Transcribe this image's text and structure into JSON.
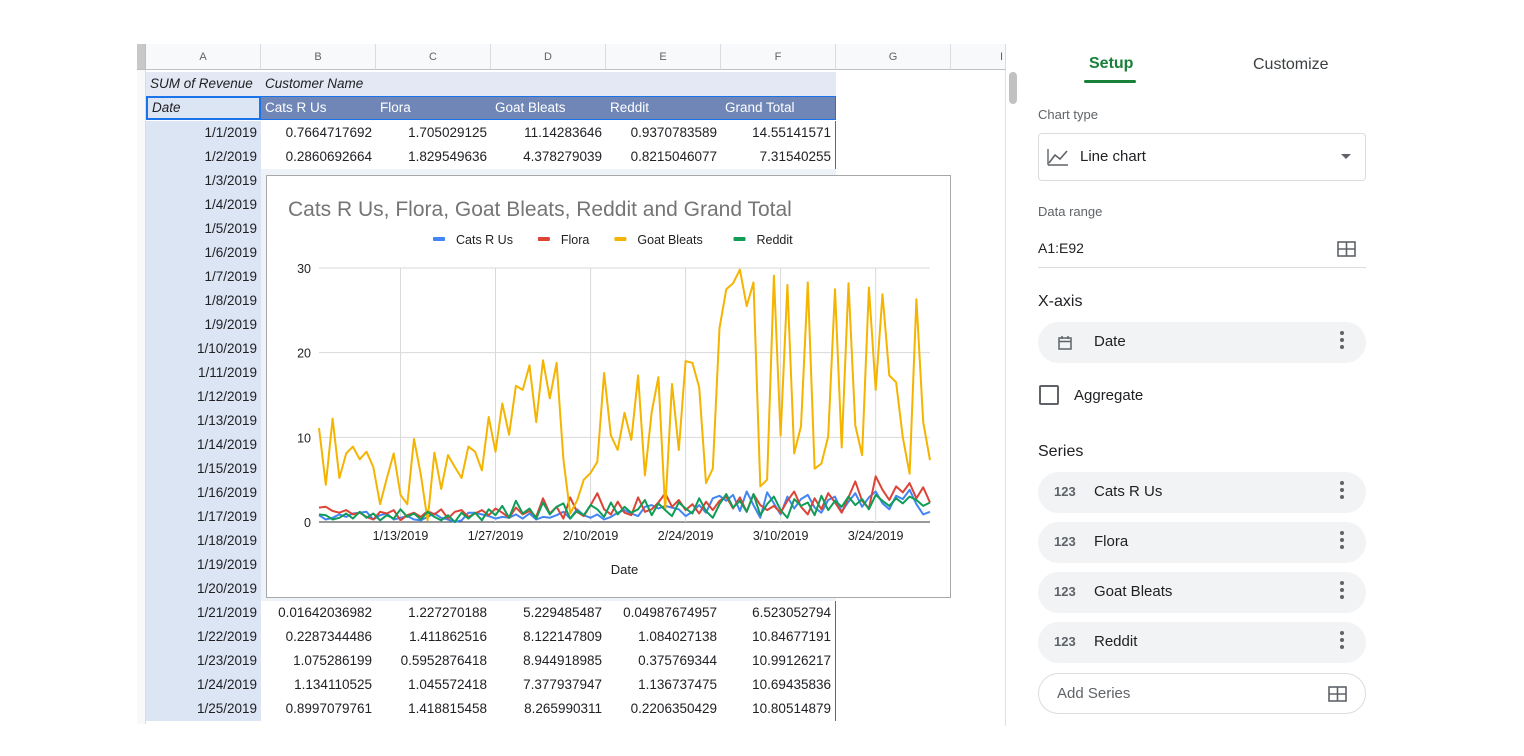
{
  "sheet": {
    "columns": [
      "A",
      "B",
      "C",
      "D",
      "E",
      "F",
      "G",
      "I"
    ],
    "pivot_title": "SUM of Revenue",
    "customer_label": "Customer Name",
    "header_row": [
      "Date",
      "Cats R Us",
      "Flora",
      "Goat Bleats",
      "Reddit",
      "Grand Total"
    ],
    "rows": [
      [
        "1/1/2019",
        "0.7664717692",
        "1.705029125",
        "11.14283646",
        "0.9370783589",
        "14.55141571"
      ],
      [
        "1/2/2019",
        "0.2860692664",
        "1.829549636",
        "4.378279039",
        "0.8215046077",
        "7.31540255"
      ],
      [
        "1/3/2019"
      ],
      [
        "1/4/2019"
      ],
      [
        "1/5/2019"
      ],
      [
        "1/6/2019"
      ],
      [
        "1/7/2019"
      ],
      [
        "1/8/2019"
      ],
      [
        "1/9/2019"
      ],
      [
        "1/10/2019"
      ],
      [
        "1/11/2019"
      ],
      [
        "1/12/2019"
      ],
      [
        "1/13/2019"
      ],
      [
        "1/14/2019"
      ],
      [
        "1/15/2019"
      ],
      [
        "1/16/2019"
      ],
      [
        "1/17/2019"
      ],
      [
        "1/18/2019"
      ],
      [
        "1/19/2019"
      ],
      [
        "1/20/2019"
      ],
      [
        "1/21/2019",
        "0.01642036982",
        "1.227270188",
        "5.229485487",
        "0.04987674957",
        "6.523052794"
      ],
      [
        "1/22/2019",
        "0.2287344486",
        "1.411862516",
        "8.122147809",
        "1.084027138",
        "10.84677191"
      ],
      [
        "1/23/2019",
        "1.075286199",
        "0.5952876418",
        "8.944918985",
        "0.375769344",
        "10.99126217"
      ],
      [
        "1/24/2019",
        "1.134110525",
        "1.045572418",
        "7.377937947",
        "1.136737475",
        "10.69435836"
      ],
      [
        "1/25/2019",
        "0.8997079761",
        "1.418815458",
        "8.265990311",
        "0.2206350429",
        "10.80514879"
      ]
    ]
  },
  "chart_data": {
    "type": "line",
    "title": "Cats R Us, Flora, Goat Bleats, Reddit and Grand Total",
    "xlabel": "Date",
    "ylabel": "",
    "ylim": [
      0,
      30
    ],
    "yticks": [
      0,
      10,
      20,
      30
    ],
    "xticks": [
      "1/13/2019",
      "1/27/2019",
      "2/10/2019",
      "2/24/2019",
      "3/10/2019",
      "3/24/2019"
    ],
    "x_start": "1/1/2019",
    "x_end": "4/1/2019",
    "legend_position": "top",
    "grid": true,
    "series": [
      {
        "name": "Cats R Us",
        "color": "#4285f4",
        "values": [
          0.8,
          0.3,
          0.5,
          0.9,
          0.6,
          1.0,
          1.1,
          1.2,
          0.3,
          0.8,
          1.0,
          0.3,
          0.5,
          0.7,
          0.3,
          0.2,
          0.6,
          1.0,
          0.5,
          0.3,
          0.0,
          0.2,
          1.1,
          1.1,
          0.9,
          0.7,
          0.4,
          0.6,
          0.5,
          0.9,
          0.4,
          1.0,
          0.3,
          0.6,
          0.5,
          0.8,
          1.2,
          0.4,
          1.5,
          0.8,
          0.5,
          0.9,
          0.3,
          0.6,
          1.1,
          1.4,
          1.0,
          0.7,
          1.8,
          2.0,
          1.6,
          1.9,
          1.7,
          1.5,
          0.7,
          1.2,
          2.0,
          1.1,
          2.8,
          3.1,
          2.5,
          3.2,
          1.3,
          3.6,
          2.0,
          0.5,
          3.5,
          2.2,
          0.9,
          3.0,
          1.6,
          2.7,
          3.2,
          1.7,
          1.1,
          2.6,
          3.0,
          1.2,
          2.4,
          3.4,
          1.8,
          2.9,
          3.6,
          2.2,
          1.5,
          3.1,
          2.7,
          3.8,
          2.1,
          0.9,
          1.2
        ]
      },
      {
        "name": "Flora",
        "color": "#db4437",
        "values": [
          1.7,
          1.8,
          1.3,
          1.1,
          1.4,
          0.9,
          1.1,
          0.6,
          0.3,
          1.2,
          1.0,
          1.4,
          0.2,
          0.8,
          1.1,
          0.6,
          1.3,
          0.9,
          1.5,
          0.4,
          1.2,
          1.4,
          0.6,
          1.0,
          1.4,
          0.8,
          1.6,
          1.1,
          0.5,
          1.7,
          0.9,
          1.3,
          0.6,
          2.8,
          1.0,
          1.8,
          0.4,
          2.9,
          1.2,
          0.7,
          2.0,
          3.4,
          1.5,
          0.9,
          2.4,
          1.1,
          0.8,
          2.9,
          1.2,
          1.5,
          2.3,
          3.4,
          1.8,
          2.6,
          1.4,
          2.1,
          1.0,
          2.4,
          1.4,
          2.5,
          3.0,
          1.6,
          2.9,
          1.2,
          3.3,
          2.0,
          1.4,
          1.9,
          1.1,
          2.5,
          3.6,
          1.8,
          0.9,
          2.8,
          1.5,
          3.4,
          2.3,
          1.1,
          2.9,
          4.8,
          2.5,
          1.6,
          5.4,
          3.8,
          2.6,
          4.2,
          3.5,
          4.6,
          2.8,
          4.1,
          2.3
        ]
      },
      {
        "name": "Goat Bleats",
        "color": "#f4b400",
        "values": [
          11.1,
          4.4,
          12.2,
          5.2,
          8.1,
          8.9,
          7.4,
          8.3,
          6.5,
          2.1,
          5.2,
          8.1,
          3.2,
          2.1,
          9.8,
          5.6,
          0.2,
          8.2,
          3.9,
          7.9,
          6.5,
          5.2,
          8.9,
          8.3,
          6.1,
          12.4,
          8.3,
          14.0,
          10.3,
          16.1,
          15.6,
          18.5,
          11.8,
          19.1,
          14.6,
          18.8,
          7.4,
          1.0,
          2.5,
          5.0,
          5.8,
          7.1,
          17.6,
          10.2,
          8.5,
          12.9,
          9.7,
          17.3,
          5.5,
          13.0,
          17.1,
          1.4,
          16.3,
          8.5,
          19.0,
          18.8,
          15.9,
          4.6,
          6.3,
          22.9,
          27.5,
          28.2,
          29.8,
          25.5,
          28.3,
          4.2,
          5.0,
          29.1,
          10.2,
          28.0,
          8.1,
          11.3,
          28.3,
          6.3,
          6.9,
          10.1,
          27.5,
          8.8,
          28.2,
          11.4,
          7.9,
          27.7,
          15.6,
          26.9,
          17.3,
          16.5,
          10.0,
          5.7,
          26.3,
          11.8,
          7.3
        ]
      },
      {
        "name": "Reddit",
        "color": "#0f9d58",
        "values": [
          0.9,
          0.8,
          0.3,
          0.5,
          1.0,
          0.4,
          1.2,
          0.5,
          1.0,
          0.2,
          0.8,
          0.4,
          1.5,
          0.6,
          1.0,
          0.3,
          1.2,
          0.6,
          0.2,
          0.8,
          0.0,
          1.1,
          0.4,
          1.1,
          0.2,
          1.5,
          0.8,
          1.9,
          0.5,
          2.5,
          1.0,
          1.6,
          0.4,
          2.3,
          0.9,
          1.8,
          2.2,
          0.4,
          1.3,
          0.8,
          2.0,
          1.5,
          0.6,
          2.3,
          0.9,
          1.8,
          1.1,
          1.5,
          2.6,
          0.8,
          2.2,
          1.4,
          0.7,
          2.3,
          1.6,
          1.0,
          2.8,
          1.3,
          0.5,
          2.1,
          3.3,
          1.7,
          2.5,
          1.2,
          3.3,
          0.8,
          2.1,
          3.0,
          1.4,
          0.5,
          2.7,
          1.9,
          2.3,
          0.8,
          3.1,
          1.4,
          2.5,
          1.8,
          3.0,
          2.0,
          2.7,
          1.5,
          3.2,
          2.5,
          1.9,
          2.8,
          2.2,
          3.0,
          2.6,
          1.9,
          2.3
        ]
      }
    ]
  },
  "panel": {
    "tab_setup": "Setup",
    "tab_customize": "Customize",
    "chart_type_label": "Chart type",
    "chart_type_value": "Line chart",
    "data_range_label": "Data range",
    "data_range_value": "A1:E92",
    "xaxis_title": "X-axis",
    "xaxis_value": "Date",
    "aggregate_label": "Aggregate",
    "series_title": "Series",
    "series_icon_text": "123",
    "series_items": [
      "Cats R Us",
      "Flora",
      "Goat Bleats",
      "Reddit"
    ],
    "add_series_label": "Add Series"
  }
}
